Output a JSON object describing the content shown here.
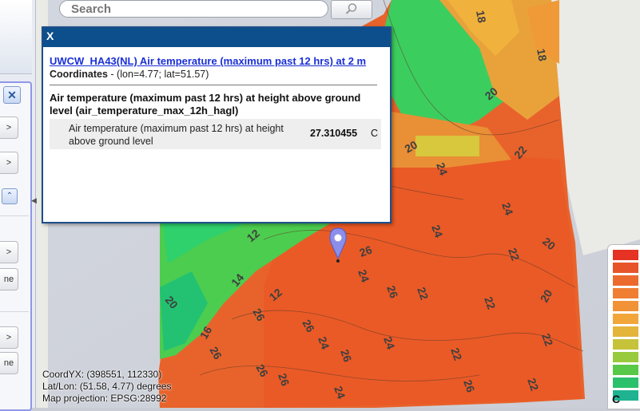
{
  "search": {
    "placeholder": "Search",
    "value": ""
  },
  "popup": {
    "close_label": "X",
    "layer_link": "UWCW_HA43(NL) Air temperature (maximum past 12 hrs) at 2 m",
    "coords_label": "Coordinates",
    "coords_value": " - (lon=4.77; lat=51.57)",
    "param_title": "Air temperature (maximum past 12 hrs) at height above ground level (air_temperature_max_12h_hagl)",
    "value_description": "Air temperature (maximum past 12 hrs) at height above ground level",
    "value": "27.310455",
    "unit": "C"
  },
  "readout": {
    "coord_yx": "CoordYX: (398551, 112330)",
    "lat_lon": "Lat/Lon: (51.58, 4.77)  degrees",
    "projection": "Map projection: EPSG:28992"
  },
  "sidebar": {
    "truncated_label": "ne"
  },
  "legend": {
    "unit": "C",
    "colors": [
      "#e53222",
      "#e8542a",
      "#ec6a2e",
      "#ef7e32",
      "#f29236",
      "#f2a63a",
      "#e4b53a",
      "#c6c23a",
      "#99c93c",
      "#58c848",
      "#2bc06b",
      "#1fb391"
    ]
  },
  "map": {
    "contour_labels": [
      "18",
      "18",
      "20",
      "20",
      "20",
      "22",
      "22",
      "22",
      "22",
      "22",
      "22",
      "24",
      "24",
      "24",
      "24",
      "24",
      "26",
      "26",
      "26",
      "26",
      "26",
      "26",
      "26",
      "26",
      "12",
      "12",
      "14",
      "16",
      "20",
      "20",
      "22",
      "24",
      "24",
      "26"
    ]
  }
}
